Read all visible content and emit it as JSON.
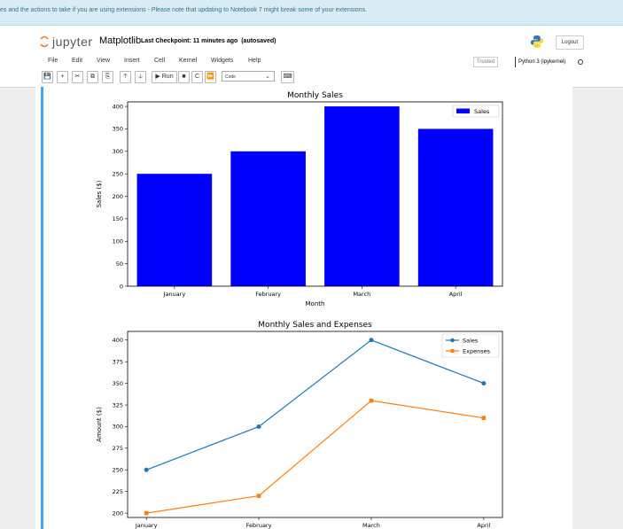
{
  "banner": {
    "text": "es and the actions to take if you are using extensions - Please note that updating to Notebook 7 might break some of your extensions."
  },
  "header": {
    "logo_text": "jupyter",
    "notebook_name": "Matplotlib",
    "checkpoint_label": "Last Checkpoint:",
    "checkpoint_time": "11 minutes ago",
    "autosave": "(autosaved)",
    "logout_label": "Logout"
  },
  "menu": {
    "items": [
      "File",
      "Edit",
      "View",
      "Insert",
      "Cell",
      "Kernel",
      "Widgets",
      "Help"
    ]
  },
  "status": {
    "trusted": "Trusted",
    "kernel": "Python 3 (ipykernel)"
  },
  "toolbar": {
    "icons": [
      "save-icon",
      "plus-icon",
      "cut-icon",
      "copy-icon",
      "paste-icon",
      "arrow-up-icon",
      "arrow-down-icon",
      "run-icon",
      "stop-icon",
      "restart-icon",
      "fast-forward-icon"
    ],
    "run_label": "Run",
    "cell_type": "Code"
  },
  "colors": {
    "accent": "#42a5f5",
    "bar": "#0000ff",
    "sales_line": "#1f77b4",
    "expenses_line": "#ff7f0e",
    "banner_bg": "#d9ecf5"
  },
  "chart_data": [
    {
      "type": "bar",
      "title": "Monthly Sales",
      "xlabel": "Month",
      "ylabel": "Sales ($)",
      "categories": [
        "January",
        "February",
        "March",
        "April"
      ],
      "series": [
        {
          "name": "Sales",
          "values": [
            250,
            300,
            400,
            350
          ]
        }
      ],
      "ylim": [
        0,
        410
      ],
      "yticks": [
        0,
        50,
        100,
        150,
        200,
        250,
        300,
        350,
        400
      ],
      "legend": "top-right",
      "grid": false
    },
    {
      "type": "line",
      "title": "Monthly Sales and Expenses",
      "xlabel": "",
      "ylabel": "Amount ($)",
      "categories": [
        "January",
        "February",
        "March",
        "April"
      ],
      "series": [
        {
          "name": "Sales",
          "values": [
            250,
            300,
            400,
            350
          ]
        },
        {
          "name": "Expenses",
          "values": [
            200,
            220,
            330,
            310
          ]
        }
      ],
      "ylim": [
        195,
        410
      ],
      "yticks": [
        200,
        225,
        250,
        275,
        300,
        325,
        350,
        375,
        400
      ],
      "legend": "top-right",
      "grid": false
    }
  ]
}
